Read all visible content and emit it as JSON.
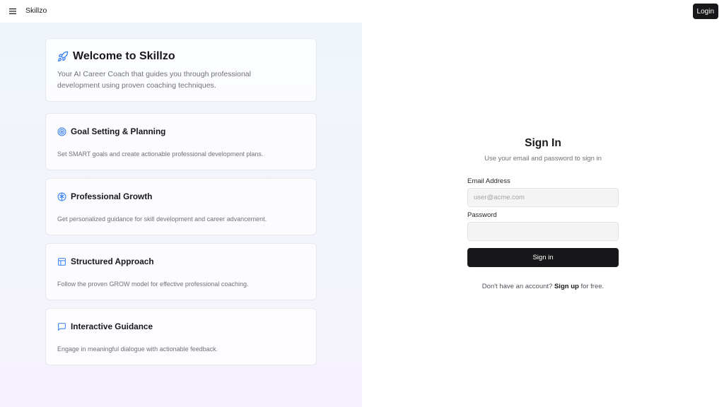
{
  "header": {
    "brand": "Skillzo",
    "login_label": "Login"
  },
  "welcome": {
    "title": "Welcome to Skillzo",
    "text": "Your AI Career Coach that guides you through professional development using proven coaching techniques."
  },
  "features": [
    {
      "title": "Goal Setting & Planning",
      "description": "Set SMART goals and create actionable professional development plans.",
      "icon": "target-icon"
    },
    {
      "title": "Professional Growth",
      "description": "Get personalized guidance for skill development and career advancement.",
      "icon": "brain-icon"
    },
    {
      "title": "Structured Approach",
      "description": "Follow the proven GROW model for effective professional coaching.",
      "icon": "layout-icon"
    },
    {
      "title": "Interactive Guidance",
      "description": "Engage in meaningful dialogue with actionable feedback.",
      "icon": "message-square-icon"
    }
  ],
  "signin": {
    "title": "Sign In",
    "subtitle": "Use your email and password to sign in",
    "email_label": "Email Address",
    "email_placeholder": "user@acme.com",
    "password_label": "Password",
    "submit_label": "Sign in",
    "signup_prefix": "Don't have an account?",
    "signup_link": "Sign up",
    "signup_suffix": "for free."
  },
  "colors": {
    "accent_blue": "#3b82f6",
    "primary_dark": "#18181b",
    "muted_text": "#71717a"
  }
}
